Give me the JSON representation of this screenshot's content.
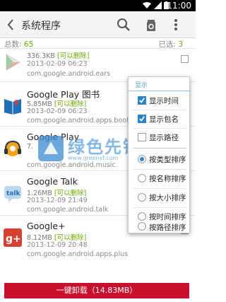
{
  "status_bar": {
    "time": "11:00"
  },
  "action_bar": {
    "title": "系统程序"
  },
  "summary": {
    "total_label": "总数:",
    "total_value": "65",
    "selected_label": "已选:",
    "selected_value": "3"
  },
  "apps": [
    {
      "name": "",
      "size": "336.3KB",
      "tag": "[可以删除]",
      "date": "2013-02-09 06:23",
      "package": "com.google.android.ears",
      "checked": false
    },
    {
      "name": "Google Play 图书",
      "size": "5.85MB",
      "tag": "[可以删除]",
      "date": "2013-02-09 06:23",
      "package": "com.google.android.apps.book",
      "checked": false
    },
    {
      "name": "Google Play",
      "size": "7.",
      "tag": "",
      "date": "",
      "package": "com.google.android.music",
      "checked": false
    },
    {
      "name": "Google Talk",
      "size": "1.26MB",
      "tag": "[可以删除]",
      "date": "2013-12-09 21:49",
      "package": "com.google.android.talk",
      "checked": false
    },
    {
      "name": "Google+",
      "size": "8.12MB",
      "tag": "[可以删除]",
      "date": "2013-12-09 20:48",
      "package": "com.google.android.apps.plus",
      "checked": false
    }
  ],
  "uninstall_button": "一键卸载（14.83MB）",
  "menu": {
    "header": "显示",
    "display_options": [
      {
        "label": "显示时间",
        "checked": true
      },
      {
        "label": "显示包名",
        "checked": true
      },
      {
        "label": "显示路径",
        "checked": false
      }
    ],
    "sort_options": [
      {
        "label": "按类型排序",
        "selected": true
      },
      {
        "label": "按名称排序",
        "selected": false
      },
      {
        "label": "按大小排序",
        "selected": false
      },
      {
        "label": "按时间排序",
        "selected": false
      },
      {
        "label": "按路径排序",
        "selected": false
      }
    ]
  },
  "watermark": {
    "text": "绿色先锋",
    "url": "www.greenxf.com"
  },
  "colors": {
    "accent_blue": "#2a86c7",
    "green_tag": "#6aa800",
    "uninstall_red": "#c8102e"
  }
}
